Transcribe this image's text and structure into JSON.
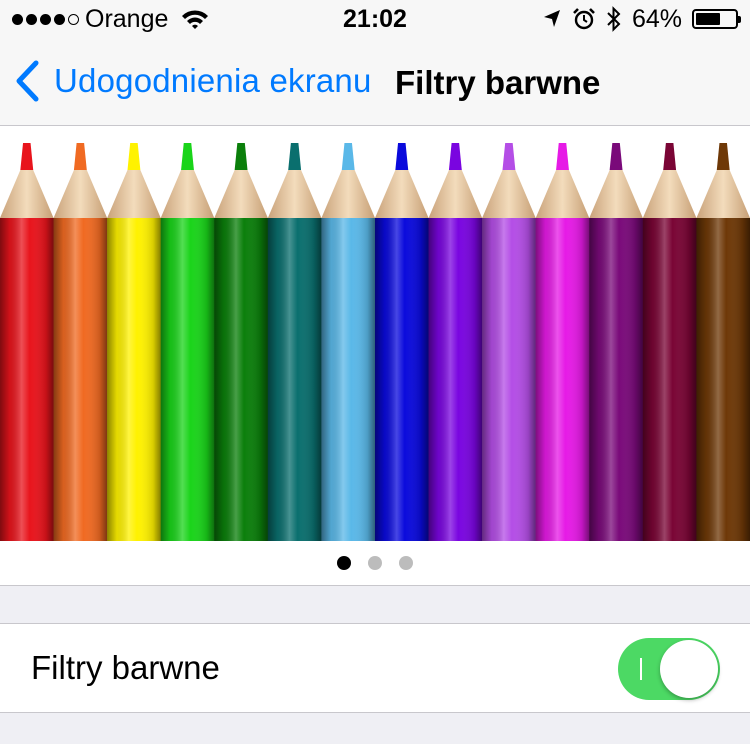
{
  "status_bar": {
    "signal_bars_filled": 4,
    "signal_bars_total": 5,
    "carrier": "Orange",
    "time": "21:02",
    "battery_percent": "64%",
    "battery_level": 0.64,
    "icons": [
      "wifi-icon",
      "location-arrow-icon",
      "alarm-icon",
      "bluetooth-icon",
      "battery-icon"
    ]
  },
  "nav": {
    "back_label": "Udogodnienia ekranu",
    "title": "Filtry barwne",
    "accent_color": "#007aff"
  },
  "banner": {
    "pencil_colors": [
      "#e8141c",
      "#f06a22",
      "#fff200",
      "#1ad41a",
      "#0b7f0b",
      "#0a6f6e",
      "#5ab8e8",
      "#0a0adc",
      "#7a05e0",
      "#b44ee6",
      "#e61ae6",
      "#7a0a7a",
      "#7a0535",
      "#6e3807"
    ],
    "page_count": 3,
    "active_page": 0
  },
  "settings": {
    "color_filters_label": "Filtry barwne",
    "color_filters_enabled": true,
    "toggle_on_color": "#4cd964"
  }
}
